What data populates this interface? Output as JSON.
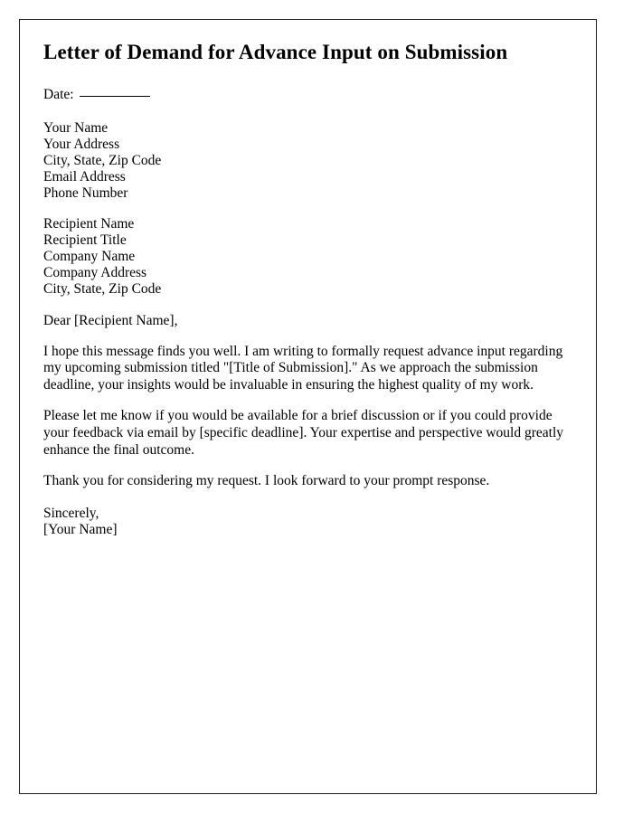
{
  "document": {
    "title": "Letter of Demand for Advance Input on Submission",
    "date_field": {
      "label": "Date:",
      "value": ""
    },
    "sender_block": [
      "Your Name",
      "Your Address",
      "City, State, Zip Code",
      "Email Address",
      "Phone Number"
    ],
    "recipient_block": [
      "Recipient Name",
      "Recipient Title",
      "Company Name",
      "Company Address",
      "City, State, Zip Code"
    ],
    "salutation": "Dear [Recipient Name],",
    "paragraphs": [
      "I hope this message finds you well. I am writing to formally request advance input regarding my upcoming submission titled \"[Title of Submission].\" As we approach the submission deadline, your insights would be invaluable in ensuring the highest quality of my work.",
      "Please let me know if you would be available for a brief discussion or if you could provide your feedback via email by [specific deadline]. Your expertise and perspective would greatly enhance the final outcome.",
      "Thank you for considering my request. I look forward to your prompt response."
    ],
    "closing": {
      "valediction": "Sincerely,",
      "signature": "[Your Name]"
    },
    "colors": {
      "text": "#000000",
      "border": "#1c1c1c",
      "background": "#ffffff"
    }
  }
}
